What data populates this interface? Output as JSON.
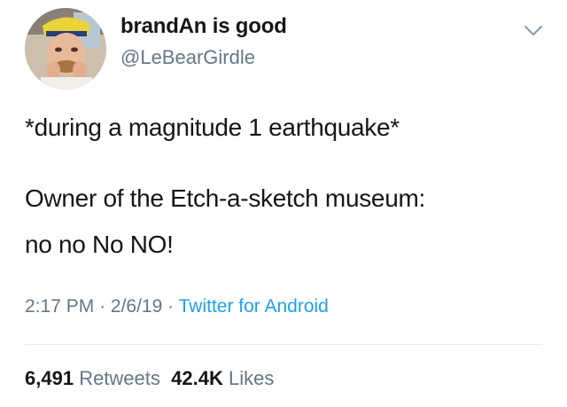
{
  "user": {
    "display_name": "brandAn is good",
    "handle": "@LeBearGirdle"
  },
  "tweet": {
    "lines": [
      "*during a magnitude 1 earthquake*",
      "Owner of the Etch-a-sketch museum:",
      "no no No NO!"
    ],
    "time": "2:17 PM",
    "date": "2/6/19",
    "separator": "·",
    "source": "Twitter for Android"
  },
  "stats": {
    "retweets_count": "6,491",
    "retweets_label": "Retweets",
    "likes_count": "42.4K",
    "likes_label": "Likes"
  },
  "icons": {
    "menu": "chevron-down-icon"
  },
  "colors": {
    "text": "#14171a",
    "muted": "#657786",
    "link": "#1da1f2",
    "divider": "#e6ecf0"
  }
}
